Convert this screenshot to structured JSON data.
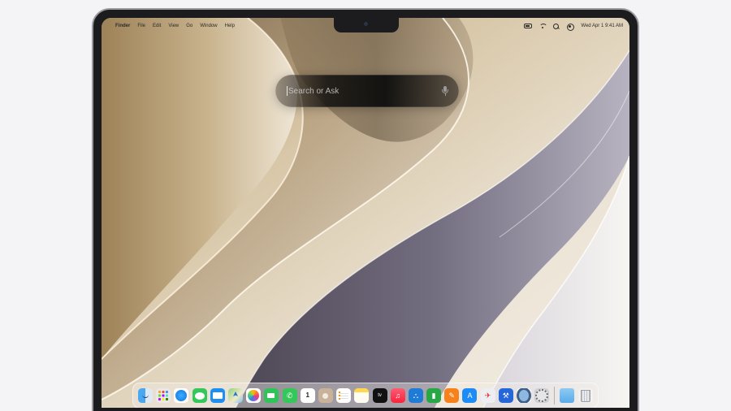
{
  "menubar": {
    "apple_glyph": "",
    "app_name": "Finder",
    "menus": [
      "File",
      "Edit",
      "View",
      "Go",
      "Window",
      "Help"
    ],
    "clock": "Wed Apr 1  9:41 AM"
  },
  "spotlight": {
    "placeholder": "Search or Ask",
    "value": ""
  },
  "dock": {
    "calendar_day": "1",
    "tv_label": "tv",
    "items": [
      {
        "name": "finder-icon",
        "glyph": ""
      },
      {
        "name": "launchpad-icon",
        "glyph": ""
      },
      {
        "name": "safari-icon",
        "glyph": ""
      },
      {
        "name": "messages-icon",
        "glyph": ""
      },
      {
        "name": "mail-icon",
        "glyph": ""
      },
      {
        "name": "maps-icon",
        "glyph": ""
      },
      {
        "name": "photos-icon",
        "glyph": ""
      },
      {
        "name": "facetime-icon",
        "glyph": ""
      },
      {
        "name": "phone-icon",
        "glyph": "✆"
      },
      {
        "name": "calendar-icon",
        "glyph": "1"
      },
      {
        "name": "contacts-icon",
        "glyph": ""
      },
      {
        "name": "reminders-icon",
        "glyph": ""
      },
      {
        "name": "notes-icon",
        "glyph": ""
      },
      {
        "name": "tv-icon",
        "glyph": "tv"
      },
      {
        "name": "music-icon",
        "glyph": "♫"
      },
      {
        "name": "keynote-icon",
        "glyph": "⛬"
      },
      {
        "name": "numbers-icon",
        "glyph": "▮"
      },
      {
        "name": "pages-icon",
        "glyph": "✎"
      },
      {
        "name": "appstore-icon",
        "glyph": "A"
      },
      {
        "name": "testflight-icon",
        "glyph": "✈"
      },
      {
        "name": "xcode-icon",
        "glyph": "⚒"
      },
      {
        "name": "safari-technology-preview-icon",
        "glyph": ""
      },
      {
        "name": "system-settings-icon",
        "glyph": ""
      }
    ],
    "extras": [
      {
        "name": "downloads-folder-icon",
        "glyph": ""
      },
      {
        "name": "trash-icon",
        "glyph": ""
      }
    ]
  },
  "colors": {
    "accent": "#1d8ff2",
    "menubar_text": "#2a2a2a",
    "search_bar_bg": "#141210"
  }
}
